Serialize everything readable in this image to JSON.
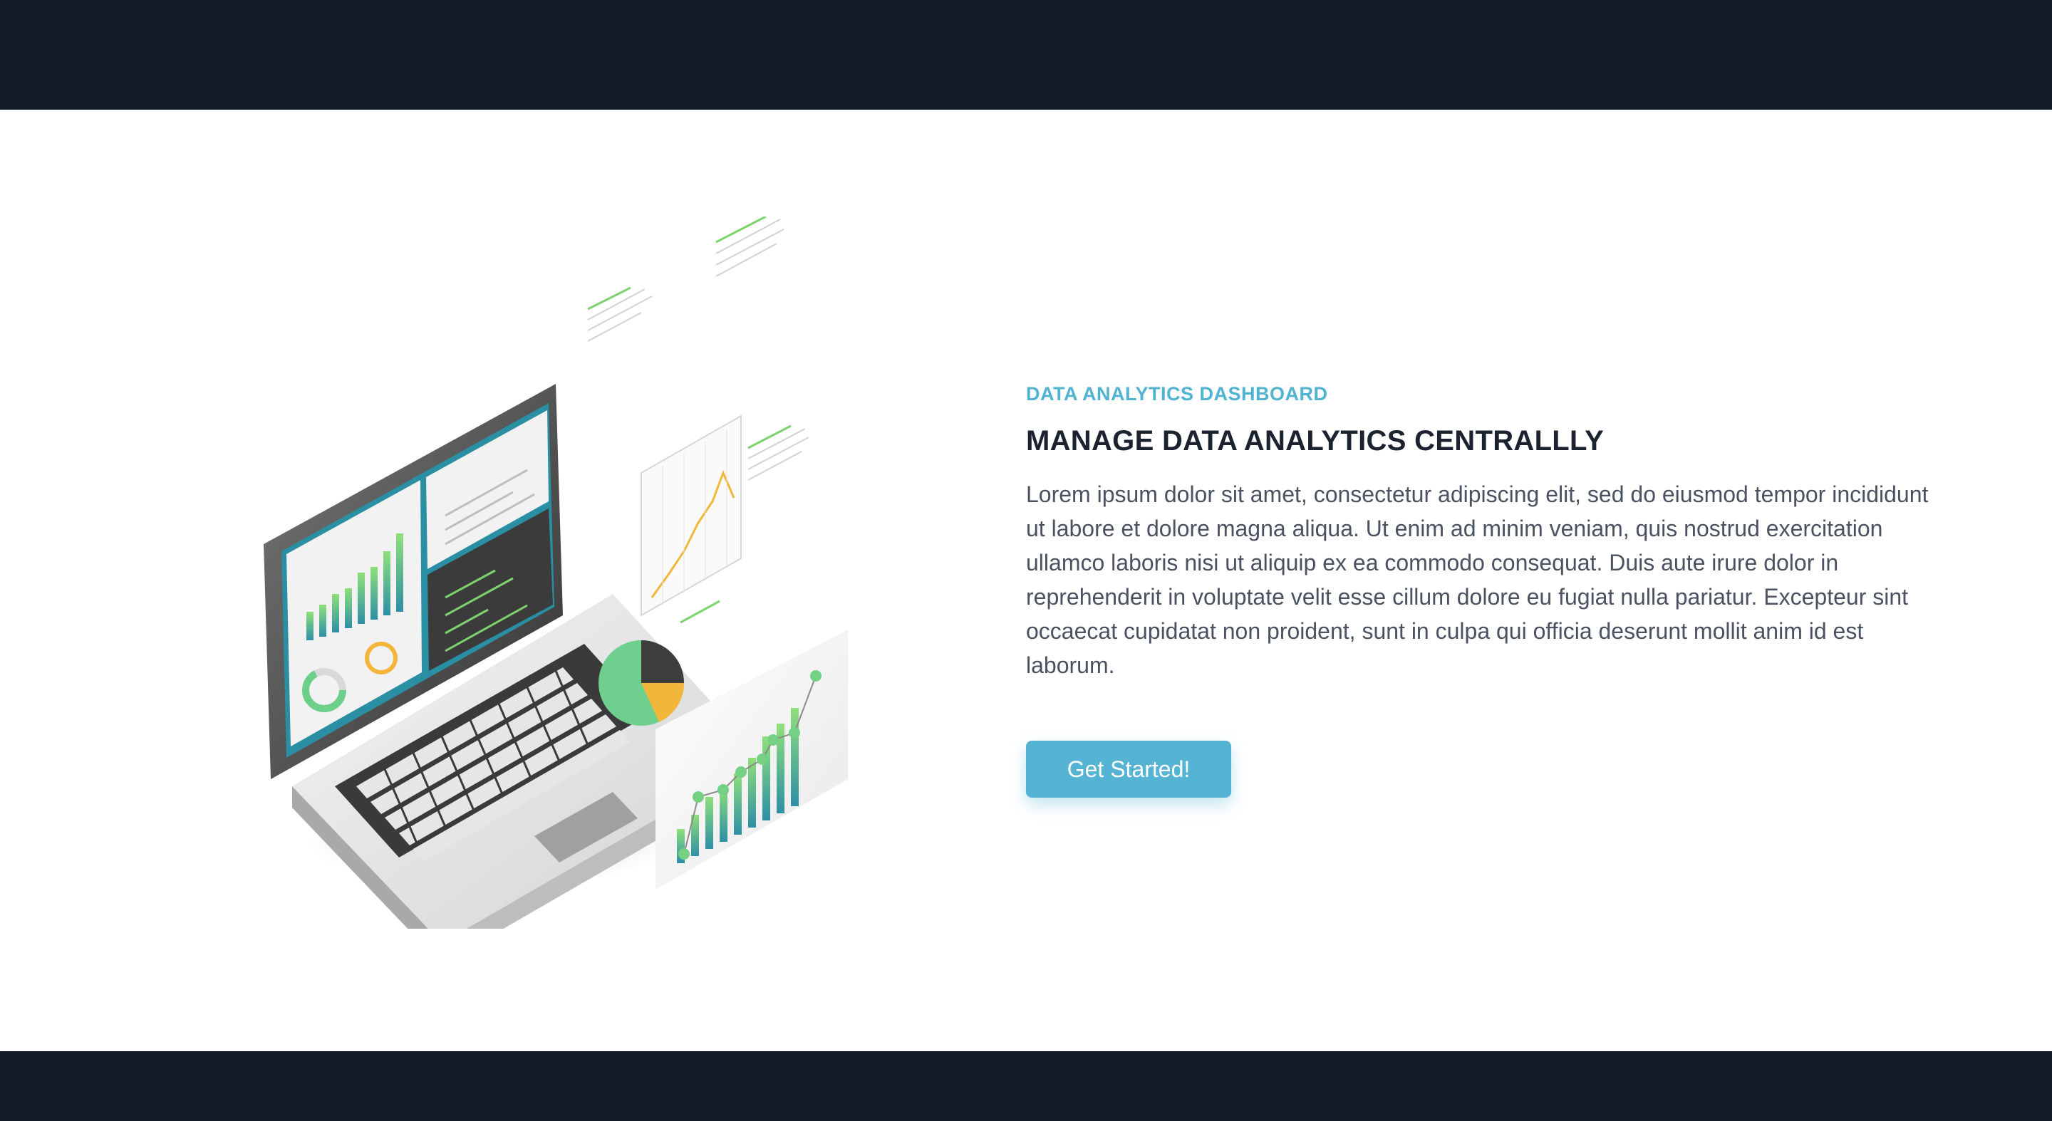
{
  "hero": {
    "eyebrow": "DATA ANALYTICS DASHBOARD",
    "headline": "MANAGE DATA ANALYTICS CENTRALLLY",
    "body": "Lorem ipsum dolor sit amet, consectetur adipiscing elit, sed do eiusmod tempor incididunt ut labore et dolore magna aliqua. Ut enim ad minim veniam, quis nostrud exercitation ullamco laboris nisi ut aliquip ex ea commodo consequat. Duis aute irure dolor in reprehenderit in voluptate velit esse cillum dolore eu fugiat nulla pariatur. Excepteur sint occaecat cupidatat non proident, sunt in culpa qui officia deserunt mollit anim id est laborum.",
    "cta_label": "Get Started!"
  },
  "illustration": {
    "icon": "isometric-laptop-analytics-illustration"
  },
  "colors": {
    "band": "#131a27",
    "accent": "#4fb3d1",
    "button": "#55b4d3",
    "headline": "#1b2230",
    "body": "#4a5261"
  }
}
